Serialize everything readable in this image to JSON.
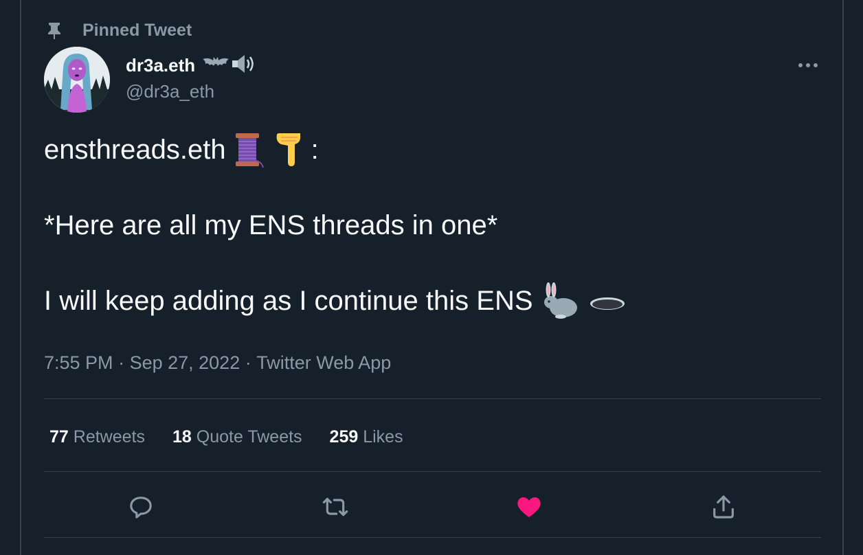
{
  "pinned": {
    "label": "Pinned Tweet",
    "icon": "pin-icon"
  },
  "author": {
    "display_name": "dr3a.eth",
    "handle": "@dr3a_eth",
    "name_emojis": [
      "bat-emoji",
      "speaker-emoji"
    ]
  },
  "tweet": {
    "line1": "ensthreads.eth",
    "line1_suffix": ":",
    "line1_emojis": [
      "thread-spool-emoji",
      "pointing-down-emoji"
    ],
    "line2": "*Here are all my ENS threads in one*",
    "line3": "I will keep adding as I continue this ENS",
    "line3_emojis": [
      "rabbit-emoji",
      "hole-emoji"
    ]
  },
  "meta": {
    "time": "7:55 PM",
    "separator": " · ",
    "date": "Sep 27, 2022",
    "source": "Twitter Web App"
  },
  "stats": {
    "retweets_count": "77",
    "retweets_label": "Retweets",
    "quotes_count": "18",
    "quotes_label": "Quote Tweets",
    "likes_count": "259",
    "likes_label": "Likes"
  },
  "actions": [
    "reply-icon",
    "retweet-icon",
    "like-icon",
    "share-icon"
  ],
  "colors": {
    "background": "#15202b",
    "text_primary": "#f7f9f9",
    "text_secondary": "#8b98a5",
    "divider": "#38444d",
    "like_active": "#f91880"
  }
}
